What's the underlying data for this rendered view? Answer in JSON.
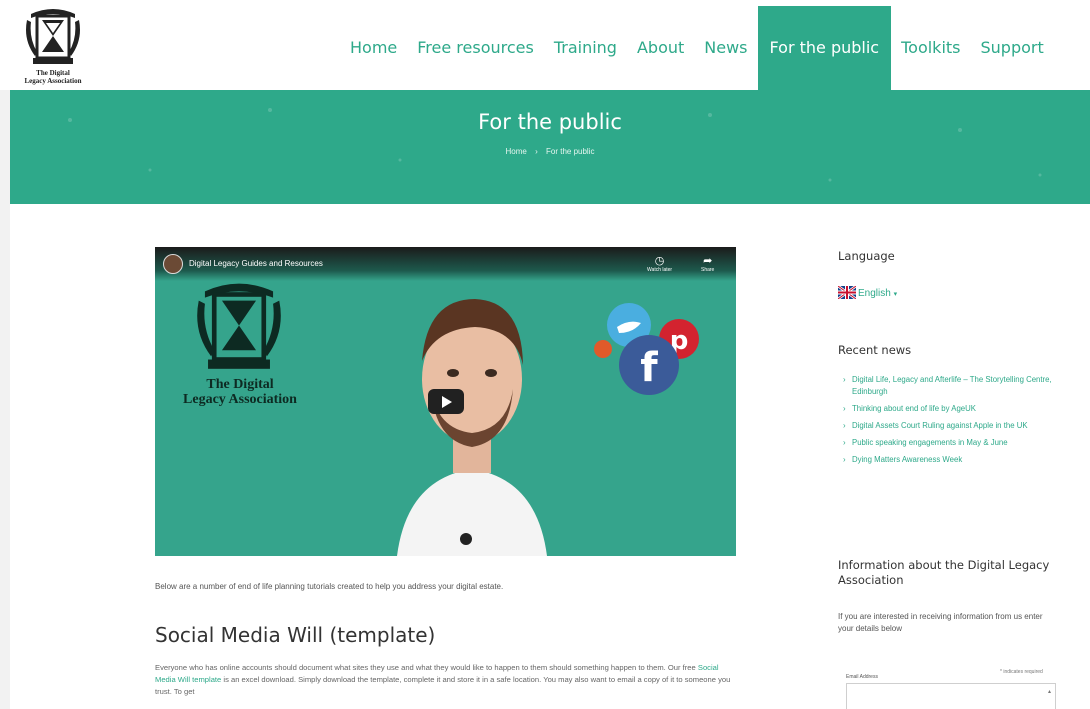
{
  "logo": {
    "line1": "The Digital",
    "line2": "Legacy Association"
  },
  "nav": {
    "items": [
      "Home",
      "Free resources",
      "Training",
      "About",
      "News",
      "For the public",
      "Toolkits",
      "Support"
    ],
    "active_index": 5
  },
  "hero": {
    "title": "For the public",
    "breadcrumb": {
      "home": "Home",
      "separator": "›",
      "current": "For the public"
    }
  },
  "video": {
    "title": "Digital Legacy Guides and Resources",
    "watch_later": "Watch later",
    "share": "Share",
    "logo_line1": "The Digital",
    "logo_line2": "Legacy Association"
  },
  "main": {
    "intro": "Below are a number of end of life planning tutorials created to help you address your digital estate.",
    "heading": "Social Media Will (template)",
    "body_part1": "Everyone who has online accounts should document what sites they use and what they would like to happen to them should something happen to them. Our free ",
    "body_link": "Social Media Will template",
    "body_part2": " is an excel download. Simply download the template, complete it and store it in a safe location. You may also want to email a copy of it to someone you trust. To get"
  },
  "sidebar": {
    "language_heading": "Language",
    "language_value": "English",
    "recent_news_heading": "Recent news",
    "recent_news": [
      "Digital Life, Legacy and Afterlife – The Storytelling Centre, Edinburgh",
      "Thinking about end of life by AgeUK",
      "Digital Assets Court Ruling against Apple in the UK",
      "Public speaking engagements in May & June",
      "Dying Matters Awareness Week"
    ],
    "info_heading": "Information about the Digital Legacy Association",
    "info_text": "If you are interested in receiving information from us enter your details below",
    "required_note": "* indicates required",
    "email_label": "Email Address"
  },
  "colors": {
    "brand": "#2ea98a",
    "nav_active_text": "#ffffff"
  }
}
